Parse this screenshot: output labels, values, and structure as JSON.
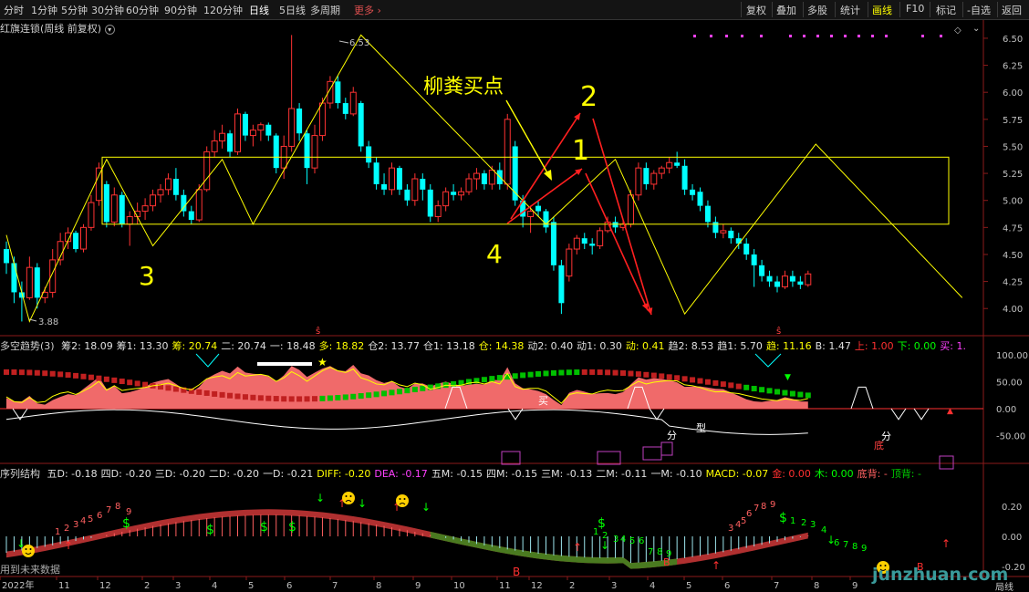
{
  "toolbar": {
    "timeframes": [
      "分时",
      "1分钟",
      "5分钟",
      "30分钟",
      "60分钟",
      "90分钟",
      "120分钟",
      "日线",
      "5日线",
      "多周期"
    ],
    "more_label": "更多",
    "more_icon": "chevron-right-icon",
    "right_buttons": [
      "复权",
      "叠加",
      "多股",
      "统计",
      "画线",
      "F10",
      "标记",
      "-自选",
      "返回"
    ],
    "highlighted_button": "画线"
  },
  "main_panel": {
    "title": "红旗连锁(周线 前复权)",
    "title_icon": "chevron-down-icon",
    "y_ticks": [
      "6.50",
      "6.25",
      "6.00",
      "5.75",
      "5.50",
      "5.25",
      "5.00",
      "4.75",
      "4.50",
      "4.25",
      "4.00"
    ],
    "high_label": "6.53",
    "low_label": "3.88",
    "annotations": {
      "title": "柳粪买点",
      "n1": "1",
      "n2": "2",
      "n3": "3",
      "n4": "4"
    }
  },
  "panel2": {
    "title": "多空趋势(3)",
    "indicators": [
      {
        "label": "筹2: 18.09",
        "color": "#e0e0e0"
      },
      {
        "label": "筹1: 13.30",
        "color": "#e0e0e0"
      },
      {
        "label": "筹: 20.74",
        "color": "#ffff00"
      },
      {
        "label": "二: 20.74",
        "color": "#e0e0e0"
      },
      {
        "label": "一: 18.48",
        "color": "#e0e0e0"
      },
      {
        "label": "多: 18.82",
        "color": "#ffff00"
      },
      {
        "label": "仓2: 13.77",
        "color": "#e0e0e0"
      },
      {
        "label": "仓1: 13.18",
        "color": "#e0e0e0"
      },
      {
        "label": "仓: 14.38",
        "color": "#ffff00"
      },
      {
        "label": "动2: 0.40",
        "color": "#e0e0e0"
      },
      {
        "label": "动1: 0.30",
        "color": "#e0e0e0"
      },
      {
        "label": "动: 0.41",
        "color": "#ffff00"
      },
      {
        "label": "趋2: 8.53",
        "color": "#e0e0e0"
      },
      {
        "label": "趋1: 5.70",
        "color": "#e0e0e0"
      },
      {
        "label": "趋: 11.16",
        "color": "#ffff00"
      },
      {
        "label": "B: 1.47",
        "color": "#e0e0e0"
      },
      {
        "label": "上: 1.00",
        "color": "#ff3030"
      },
      {
        "label": "下: 0.00",
        "color": "#00ff00"
      },
      {
        "label": "买: 1.",
        "color": "#ff40ff"
      }
    ],
    "y_ticks": [
      "100.00",
      "50.00",
      "0.00",
      "-50.00"
    ],
    "labels": {
      "mai": "买",
      "fen": "分",
      "xing": "型",
      "di": "底",
      "fen2": "分"
    }
  },
  "panel3": {
    "title": "序列结构",
    "indicators": [
      {
        "label": "五D: -0.18",
        "color": "#e0e0e0"
      },
      {
        "label": "四D: -0.20",
        "color": "#e0e0e0"
      },
      {
        "label": "三D: -0.20",
        "color": "#e0e0e0"
      },
      {
        "label": "二D: -0.20",
        "color": "#e0e0e0"
      },
      {
        "label": "一D: -0.21",
        "color": "#e0e0e0"
      },
      {
        "label": "DIFF: -0.20",
        "color": "#ffff00"
      },
      {
        "label": "DEA: -0.17",
        "color": "#ff40ff"
      },
      {
        "label": "五M: -0.15",
        "color": "#e0e0e0"
      },
      {
        "label": "四M: -0.15",
        "color": "#e0e0e0"
      },
      {
        "label": "三M: -0.13",
        "color": "#e0e0e0"
      },
      {
        "label": "二M: -0.11",
        "color": "#e0e0e0"
      },
      {
        "label": "一M: -0.10",
        "color": "#e0e0e0"
      },
      {
        "label": "MACD: -0.07",
        "color": "#ffff00"
      },
      {
        "label": "金: 0.00",
        "color": "#ff3030"
      },
      {
        "label": "木: 0.00",
        "color": "#00ff00"
      },
      {
        "label": "底背: -",
        "color": "#ff6060"
      },
      {
        "label": "顶背: -",
        "color": "#00cc00"
      }
    ],
    "y_ticks": [
      "0.20",
      "0.00",
      "-0.20"
    ],
    "future_note": "用到未来数据"
  },
  "x_axis": {
    "labels": [
      "2022年",
      "11",
      "12",
      "2",
      "3",
      "4",
      "5",
      "6",
      "7",
      "8",
      "9",
      "10",
      "11",
      "12",
      "2",
      "3",
      "4",
      "5",
      "6",
      "7",
      "8",
      "9"
    ]
  },
  "status_right": "局线",
  "watermark": "junzhuan.com",
  "chart_data": {
    "type": "candlestick",
    "title": "红旗连锁(周线 前复权)",
    "ylim": [
      3.85,
      6.55
    ],
    "high": 6.53,
    "low": 3.88,
    "candles": [
      {
        "o": 4.55,
        "h": 4.62,
        "l": 4.32,
        "c": 4.42,
        "up": false
      },
      {
        "o": 4.42,
        "h": 4.48,
        "l": 4.05,
        "c": 4.15,
        "up": false
      },
      {
        "o": 4.15,
        "h": 4.25,
        "l": 3.88,
        "c": 4.1,
        "up": false
      },
      {
        "o": 4.1,
        "h": 4.48,
        "l": 4.08,
        "c": 4.38,
        "up": true
      },
      {
        "o": 4.38,
        "h": 4.42,
        "l": 4.0,
        "c": 4.1,
        "up": false
      },
      {
        "o": 4.1,
        "h": 4.2,
        "l": 4.05,
        "c": 4.15,
        "up": true
      },
      {
        "o": 4.15,
        "h": 4.55,
        "l": 4.1,
        "c": 4.45,
        "up": true
      },
      {
        "o": 4.45,
        "h": 4.7,
        "l": 4.4,
        "c": 4.62,
        "up": true
      },
      {
        "o": 4.62,
        "h": 4.75,
        "l": 4.55,
        "c": 4.7,
        "up": true
      },
      {
        "o": 4.7,
        "h": 4.72,
        "l": 4.52,
        "c": 4.55,
        "up": false
      },
      {
        "o": 4.55,
        "h": 4.78,
        "l": 4.52,
        "c": 4.75,
        "up": true
      },
      {
        "o": 4.75,
        "h": 5.05,
        "l": 4.72,
        "c": 4.98,
        "up": true
      },
      {
        "o": 5.0,
        "h": 5.35,
        "l": 4.95,
        "c": 5.3,
        "up": true
      },
      {
        "o": 5.15,
        "h": 5.18,
        "l": 4.75,
        "c": 4.8,
        "up": false
      },
      {
        "o": 4.8,
        "h": 5.12,
        "l": 4.76,
        "c": 5.05,
        "up": true
      },
      {
        "o": 5.05,
        "h": 5.08,
        "l": 4.75,
        "c": 4.78,
        "up": false
      },
      {
        "o": 4.78,
        "h": 4.9,
        "l": 4.58,
        "c": 4.85,
        "up": true
      },
      {
        "o": 4.85,
        "h": 4.98,
        "l": 4.78,
        "c": 4.9,
        "up": true
      },
      {
        "o": 4.9,
        "h": 5.02,
        "l": 4.82,
        "c": 4.95,
        "up": true
      },
      {
        "o": 4.95,
        "h": 5.1,
        "l": 4.9,
        "c": 5.05,
        "up": true
      },
      {
        "o": 5.05,
        "h": 5.15,
        "l": 4.98,
        "c": 5.1,
        "up": true
      },
      {
        "o": 5.1,
        "h": 5.25,
        "l": 5.05,
        "c": 5.2,
        "up": true
      },
      {
        "o": 5.2,
        "h": 5.3,
        "l": 5.0,
        "c": 5.05,
        "up": false
      },
      {
        "o": 5.05,
        "h": 5.1,
        "l": 4.85,
        "c": 4.9,
        "up": false
      },
      {
        "o": 4.9,
        "h": 4.95,
        "l": 4.78,
        "c": 4.82,
        "up": false
      },
      {
        "o": 4.82,
        "h": 5.15,
        "l": 4.8,
        "c": 5.1,
        "up": true
      },
      {
        "o": 5.1,
        "h": 5.5,
        "l": 5.08,
        "c": 5.45,
        "up": true
      },
      {
        "o": 5.45,
        "h": 5.65,
        "l": 5.4,
        "c": 5.55,
        "up": true
      },
      {
        "o": 5.55,
        "h": 5.7,
        "l": 5.48,
        "c": 5.62,
        "up": true
      },
      {
        "o": 5.62,
        "h": 5.65,
        "l": 5.4,
        "c": 5.45,
        "up": false
      },
      {
        "o": 5.45,
        "h": 5.85,
        "l": 5.42,
        "c": 5.8,
        "up": true
      },
      {
        "o": 5.8,
        "h": 5.82,
        "l": 5.55,
        "c": 5.6,
        "up": false
      },
      {
        "o": 5.6,
        "h": 5.7,
        "l": 5.5,
        "c": 5.65,
        "up": true
      },
      {
        "o": 5.65,
        "h": 5.72,
        "l": 5.55,
        "c": 5.7,
        "up": true
      },
      {
        "o": 5.7,
        "h": 5.72,
        "l": 5.55,
        "c": 5.6,
        "up": false
      },
      {
        "o": 5.6,
        "h": 5.62,
        "l": 5.25,
        "c": 5.3,
        "up": false
      },
      {
        "o": 5.3,
        "h": 5.6,
        "l": 5.2,
        "c": 5.5,
        "up": true
      },
      {
        "o": 5.5,
        "h": 6.53,
        "l": 5.45,
        "c": 5.85,
        "up": true
      },
      {
        "o": 5.85,
        "h": 5.9,
        "l": 5.55,
        "c": 5.62,
        "up": false
      },
      {
        "o": 5.62,
        "h": 5.65,
        "l": 5.15,
        "c": 5.3,
        "up": false
      },
      {
        "o": 5.3,
        "h": 5.7,
        "l": 5.25,
        "c": 5.6,
        "up": true
      },
      {
        "o": 5.6,
        "h": 5.95,
        "l": 5.55,
        "c": 5.9,
        "up": true
      },
      {
        "o": 5.9,
        "h": 6.15,
        "l": 5.85,
        "c": 6.1,
        "up": true
      },
      {
        "o": 6.1,
        "h": 6.15,
        "l": 5.85,
        "c": 5.9,
        "up": false
      },
      {
        "o": 5.9,
        "h": 5.95,
        "l": 5.75,
        "c": 5.8,
        "up": false
      },
      {
        "o": 5.8,
        "h": 6.05,
        "l": 5.78,
        "c": 6.0,
        "up": true
      },
      {
        "o": 5.9,
        "h": 5.92,
        "l": 5.45,
        "c": 5.5,
        "up": false
      },
      {
        "o": 5.5,
        "h": 5.55,
        "l": 5.3,
        "c": 5.35,
        "up": false
      },
      {
        "o": 5.35,
        "h": 5.4,
        "l": 5.1,
        "c": 5.15,
        "up": false
      },
      {
        "o": 5.15,
        "h": 5.25,
        "l": 5.05,
        "c": 5.1,
        "up": false
      },
      {
        "o": 5.1,
        "h": 5.35,
        "l": 5.05,
        "c": 5.3,
        "up": true
      },
      {
        "o": 5.3,
        "h": 5.32,
        "l": 5.05,
        "c": 5.1,
        "up": false
      },
      {
        "o": 5.1,
        "h": 5.15,
        "l": 4.95,
        "c": 5.0,
        "up": false
      },
      {
        "o": 5.0,
        "h": 5.25,
        "l": 4.95,
        "c": 5.2,
        "up": true
      },
      {
        "o": 5.2,
        "h": 5.25,
        "l": 5.0,
        "c": 5.1,
        "up": false
      },
      {
        "o": 5.1,
        "h": 5.15,
        "l": 4.8,
        "c": 4.85,
        "up": false
      },
      {
        "o": 4.85,
        "h": 5.0,
        "l": 4.8,
        "c": 4.95,
        "up": true
      },
      {
        "o": 4.95,
        "h": 5.12,
        "l": 4.9,
        "c": 5.08,
        "up": true
      },
      {
        "o": 5.08,
        "h": 5.15,
        "l": 5.0,
        "c": 5.05,
        "up": false
      },
      {
        "o": 5.05,
        "h": 5.12,
        "l": 5.0,
        "c": 5.08,
        "up": true
      },
      {
        "o": 5.08,
        "h": 5.25,
        "l": 5.05,
        "c": 5.2,
        "up": true
      },
      {
        "o": 5.2,
        "h": 5.3,
        "l": 5.1,
        "c": 5.25,
        "up": true
      },
      {
        "o": 5.25,
        "h": 5.28,
        "l": 5.1,
        "c": 5.15,
        "up": false
      },
      {
        "o": 5.15,
        "h": 5.32,
        "l": 5.1,
        "c": 5.28,
        "up": true
      },
      {
        "o": 5.28,
        "h": 5.35,
        "l": 5.1,
        "c": 5.15,
        "up": false
      },
      {
        "o": 5.15,
        "h": 5.8,
        "l": 5.1,
        "c": 5.75,
        "up": true
      },
      {
        "o": 5.5,
        "h": 5.55,
        "l": 4.95,
        "c": 5.0,
        "up": false
      },
      {
        "o": 5.0,
        "h": 5.05,
        "l": 4.75,
        "c": 4.85,
        "up": false
      },
      {
        "o": 4.85,
        "h": 4.95,
        "l": 4.7,
        "c": 4.9,
        "up": true
      },
      {
        "o": 4.95,
        "h": 5.0,
        "l": 4.85,
        "c": 4.9,
        "up": false
      },
      {
        "o": 4.9,
        "h": 4.92,
        "l": 4.7,
        "c": 4.75,
        "up": false
      },
      {
        "o": 4.8,
        "h": 4.85,
        "l": 4.35,
        "c": 4.4,
        "up": false
      },
      {
        "o": 4.4,
        "h": 4.45,
        "l": 3.95,
        "c": 4.05,
        "up": false
      },
      {
        "o": 4.3,
        "h": 4.6,
        "l": 4.25,
        "c": 4.55,
        "up": true
      },
      {
        "o": 4.55,
        "h": 4.68,
        "l": 4.5,
        "c": 4.65,
        "up": true
      },
      {
        "o": 4.65,
        "h": 4.7,
        "l": 4.55,
        "c": 4.6,
        "up": false
      },
      {
        "o": 4.6,
        "h": 4.65,
        "l": 4.5,
        "c": 4.58,
        "up": false
      },
      {
        "o": 4.58,
        "h": 4.75,
        "l": 4.55,
        "c": 4.72,
        "up": true
      },
      {
        "o": 4.72,
        "h": 4.85,
        "l": 4.7,
        "c": 4.8,
        "up": true
      },
      {
        "o": 4.8,
        "h": 4.85,
        "l": 4.7,
        "c": 4.75,
        "up": false
      },
      {
        "o": 4.75,
        "h": 4.82,
        "l": 4.72,
        "c": 4.78,
        "up": true
      },
      {
        "o": 4.78,
        "h": 5.1,
        "l": 4.75,
        "c": 5.05,
        "up": true
      },
      {
        "o": 5.05,
        "h": 5.35,
        "l": 5.0,
        "c": 5.3,
        "up": true
      },
      {
        "o": 5.3,
        "h": 5.35,
        "l": 5.1,
        "c": 5.15,
        "up": false
      },
      {
        "o": 5.15,
        "h": 5.28,
        "l": 5.1,
        "c": 5.25,
        "up": true
      },
      {
        "o": 5.25,
        "h": 5.32,
        "l": 5.2,
        "c": 5.3,
        "up": true
      },
      {
        "o": 5.3,
        "h": 5.4,
        "l": 5.25,
        "c": 5.35,
        "up": true
      },
      {
        "o": 5.35,
        "h": 5.45,
        "l": 5.3,
        "c": 5.32,
        "up": false
      },
      {
        "o": 5.32,
        "h": 5.38,
        "l": 5.05,
        "c": 5.1,
        "up": false
      },
      {
        "o": 5.1,
        "h": 5.15,
        "l": 5.0,
        "c": 5.05,
        "up": false
      },
      {
        "o": 5.08,
        "h": 5.12,
        "l": 4.9,
        "c": 4.95,
        "up": false
      },
      {
        "o": 4.95,
        "h": 5.0,
        "l": 4.75,
        "c": 4.8,
        "up": false
      },
      {
        "o": 4.8,
        "h": 4.85,
        "l": 4.65,
        "c": 4.7,
        "up": false
      },
      {
        "o": 4.7,
        "h": 4.78,
        "l": 4.65,
        "c": 4.72,
        "up": true
      },
      {
        "o": 4.72,
        "h": 4.75,
        "l": 4.6,
        "c": 4.65,
        "up": false
      },
      {
        "o": 4.65,
        "h": 4.7,
        "l": 4.55,
        "c": 4.6,
        "up": false
      },
      {
        "o": 4.6,
        "h": 4.65,
        "l": 4.45,
        "c": 4.5,
        "up": false
      },
      {
        "o": 4.5,
        "h": 4.55,
        "l": 4.2,
        "c": 4.4,
        "up": false
      },
      {
        "o": 4.4,
        "h": 4.45,
        "l": 4.25,
        "c": 4.3,
        "up": false
      },
      {
        "o": 4.3,
        "h": 4.35,
        "l": 4.2,
        "c": 4.25,
        "up": false
      },
      {
        "o": 4.25,
        "h": 4.3,
        "l": 4.15,
        "c": 4.2,
        "up": false
      },
      {
        "o": 4.2,
        "h": 4.35,
        "l": 4.18,
        "c": 4.3,
        "up": true
      },
      {
        "o": 4.3,
        "h": 4.35,
        "l": 4.2,
        "c": 4.25,
        "up": false
      },
      {
        "o": 4.25,
        "h": 4.3,
        "l": 4.18,
        "c": 4.22,
        "up": false
      },
      {
        "o": 4.22,
        "h": 4.35,
        "l": 4.2,
        "c": 4.32,
        "up": true
      }
    ],
    "zigzag_yellow": [
      [
        4.68,
        0
      ],
      [
        3.88,
        3
      ],
      [
        5.38,
        13
      ],
      [
        4.58,
        19
      ],
      [
        5.38,
        28
      ],
      [
        4.78,
        32
      ],
      [
        6.53,
        46
      ],
      [
        4.78,
        70
      ],
      [
        5.38,
        79
      ],
      [
        3.95,
        88
      ],
      [
        5.52,
        105
      ],
      [
        4.1,
        124
      ]
    ],
    "rect_box": {
      "top": 5.4,
      "bottom": 4.78
    },
    "panel2_yticks": [
      100,
      50,
      0,
      -50
    ],
    "panel3_yticks": [
      0.2,
      0.0,
      -0.2
    ]
  }
}
